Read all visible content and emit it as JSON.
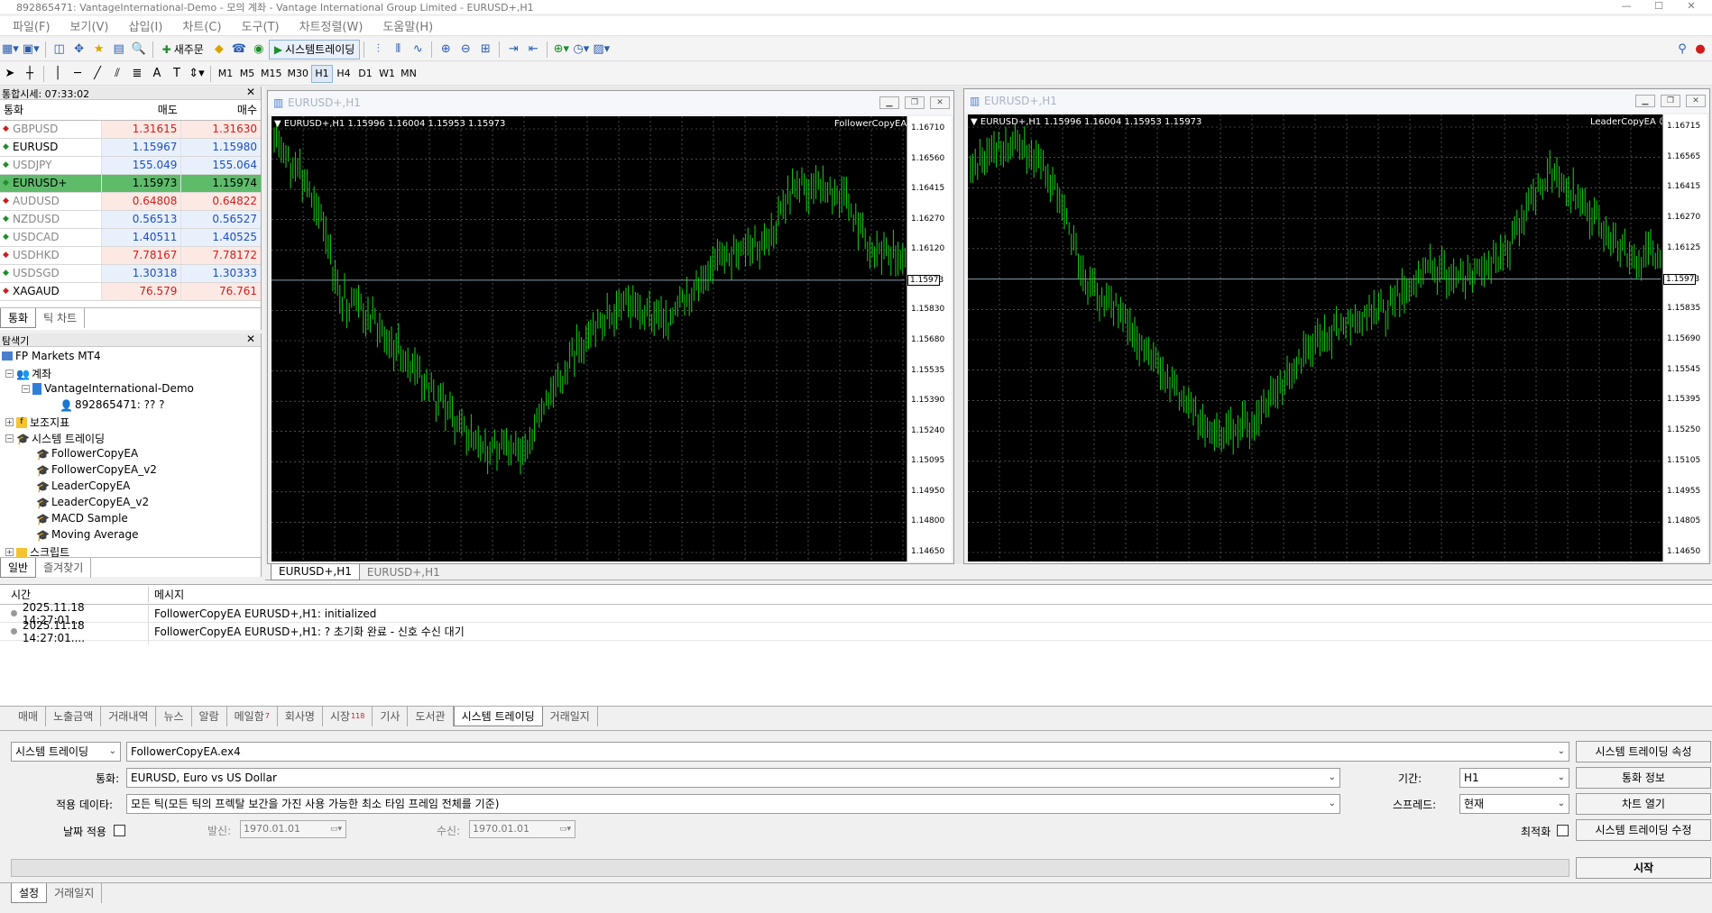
{
  "window": {
    "title": "892865471: VantageInternational-Demo - 모의 계좌 - Vantage International Group Limited - EURUSD+,H1"
  },
  "menu": [
    "파일(F)",
    "보기(V)",
    "삽입(I)",
    "차트(C)",
    "도구(T)",
    "차트정렬(W)",
    "도움말(H)"
  ],
  "toolbar": {
    "new_order": "새주문",
    "auto_trading": "시스템트레이딩",
    "timeframes": [
      "M1",
      "M5",
      "M15",
      "M30",
      "H1",
      "H4",
      "D1",
      "W1",
      "MN"
    ],
    "active_timeframe": "H1"
  },
  "market_watch": {
    "title": "통합시세: 07:33:02",
    "headers": [
      "통화",
      "매도",
      "매수"
    ],
    "rows": [
      {
        "symbol": "GBPUSD",
        "bid": "1.31615",
        "ask": "1.31630",
        "dir": "down"
      },
      {
        "symbol": "EURUSD",
        "bid": "1.15967",
        "ask": "1.15980",
        "dir": "up"
      },
      {
        "symbol": "USDJPY",
        "bid": "155.049",
        "ask": "155.064",
        "dir": "up"
      },
      {
        "symbol": "EURUSD+",
        "bid": "1.15973",
        "ask": "1.15974",
        "dir": "up"
      },
      {
        "symbol": "AUDUSD",
        "bid": "0.64808",
        "ask": "0.64822",
        "dir": "down"
      },
      {
        "symbol": "NZDUSD",
        "bid": "0.56513",
        "ask": "0.56527",
        "dir": "up"
      },
      {
        "symbol": "USDCAD",
        "bid": "1.40511",
        "ask": "1.40525",
        "dir": "up"
      },
      {
        "symbol": "USDHKD",
        "bid": "7.78167",
        "ask": "7.78172",
        "dir": "down"
      },
      {
        "symbol": "USDSGD",
        "bid": "1.30318",
        "ask": "1.30333",
        "dir": "up"
      },
      {
        "symbol": "XAGAUD",
        "bid": "76.579",
        "ask": "76.761",
        "dir": "down"
      }
    ],
    "tabs": [
      "통화",
      "틱 차트"
    ]
  },
  "navigator": {
    "title": "탐색기",
    "root": "FP Markets MT4",
    "accounts": "계좌",
    "server": "VantageInternational-Demo",
    "login": "892865471: ?? ?",
    "indicators": "보조지표",
    "experts": "시스템 트레이딩",
    "ea_list": [
      "FollowerCopyEA",
      "FollowerCopyEA_v2",
      "LeaderCopyEA",
      "LeaderCopyEA_v2",
      "MACD Sample",
      "Moving Average"
    ],
    "scripts": "스크립트",
    "tabs": [
      "일반",
      "즐겨찾기"
    ]
  },
  "charts": [
    {
      "window_title": "EURUSD+,H1",
      "info": "EURUSD+,H1  1.15996 1.16004 1.15953 1.15973",
      "ea": "FollowerCopyEA ☺",
      "price_labels": [
        "1.16710",
        "1.16560",
        "1.16415",
        "1.16270",
        "1.16120",
        "1.15973",
        "1.15830",
        "1.15680",
        "1.15535",
        "1.15390",
        "1.15240",
        "1.15095",
        "1.14950",
        "1.14800",
        "1.14650"
      ],
      "current": "1.15973"
    },
    {
      "window_title": "EURUSD+,H1",
      "info": "EURUSD+,H1  1.15996 1.16004 1.15953 1.15973",
      "ea": "LeaderCopyEA ☺",
      "price_labels": [
        "1.16715",
        "1.16565",
        "1.16415",
        "1.16270",
        "1.16125",
        "1.15973",
        "1.15835",
        "1.15690",
        "1.15545",
        "1.15395",
        "1.15250",
        "1.15105",
        "1.14955",
        "1.14805",
        "1.14650"
      ],
      "current": "1.15973"
    }
  ],
  "chart_tabs": [
    "EURUSD+,H1",
    "EURUSD+,H1"
  ],
  "journal": {
    "headers": [
      "시간",
      "메시지"
    ],
    "rows": [
      {
        "time": "2025.11.18 14:27:01....",
        "msg": "FollowerCopyEA EURUSD+,H1: initialized"
      },
      {
        "time": "2025.11.18 14:27:01....",
        "msg": "FollowerCopyEA EURUSD+,H1: ? 초기화 완료 - 신호 수신 대기"
      }
    ]
  },
  "terminal_tabs": [
    {
      "label": "매매"
    },
    {
      "label": "노출금액"
    },
    {
      "label": "거래내역"
    },
    {
      "label": "뉴스"
    },
    {
      "label": "알람"
    },
    {
      "label": "메일함",
      "badge": "7"
    },
    {
      "label": "회사명"
    },
    {
      "label": "시장",
      "badge": "118"
    },
    {
      "label": "기사"
    },
    {
      "label": "도서관"
    },
    {
      "label": "시스템 트레이딩",
      "active": true
    },
    {
      "label": "거래일지"
    }
  ],
  "tester": {
    "type": "시스템 트레이딩",
    "expert": "FollowerCopyEA.ex4",
    "symbol_label": "통화:",
    "symbol": "EURUSD, Euro vs US Dollar",
    "model_label": "적용 데이타:",
    "model": "모든 틱(모든 틱의 프렉탈 보간을 가진 사용 가능한 최소 타임 프레임 전체를 기준)",
    "date_label": "날짜 적용",
    "from_label": "발신:",
    "from": "1970.01.01",
    "to_label": "수신:",
    "to": "1970.01.01",
    "period_label": "기간:",
    "period": "H1",
    "spread_label": "스프레드:",
    "spread": "현재",
    "optimize_label": "최적화",
    "btn_props": "시스템 트레이딩 속성",
    "btn_symbol": "통화 정보",
    "btn_chart": "차트 열기",
    "btn_modify": "시스템 트레이딩 수정",
    "btn_start": "시작",
    "tabs": [
      "설정",
      "거래일지"
    ]
  }
}
